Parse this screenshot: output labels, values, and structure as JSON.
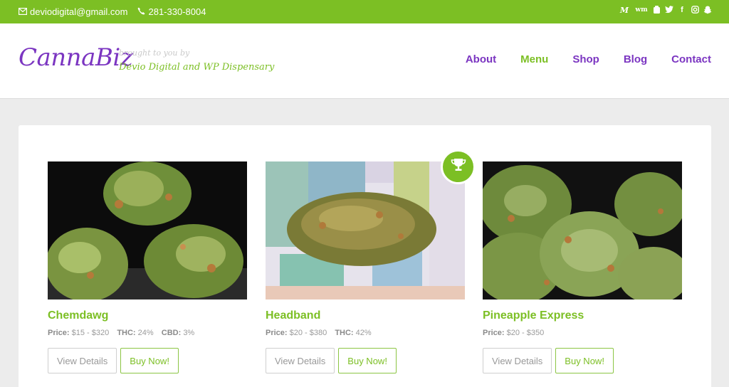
{
  "topbar": {
    "email": "deviodigital@gmail.com",
    "phone": "281-330-8004",
    "social_icons": [
      "weedmaps-icon",
      "wm-icon",
      "leafly-icon",
      "twitter-icon",
      "facebook-icon",
      "instagram-icon",
      "snapchat-icon"
    ],
    "bg_color": "#7cbf24"
  },
  "header": {
    "logo": "CannaBiz",
    "tagline_line1": "brought to you by",
    "tagline_line2": "Devio Digital and WP Dispensary",
    "nav": [
      {
        "label": "About",
        "active": false
      },
      {
        "label": "Menu",
        "active": true
      },
      {
        "label": "Shop",
        "active": false
      },
      {
        "label": "Blog",
        "active": false
      },
      {
        "label": "Contact",
        "active": false
      }
    ],
    "brand_color": "#7b35c1",
    "accent_color": "#7cbf24"
  },
  "products": [
    {
      "name": "Chemdawg",
      "price_label": "Price:",
      "price": "$15 - $320",
      "thc_label": "THC:",
      "thc": "24%",
      "cbd_label": "CBD:",
      "cbd": "3%",
      "view_label": "View Details",
      "buy_label": "Buy Now!"
    },
    {
      "name": "Headband",
      "price_label": "Price:",
      "price": "$20 - $380",
      "thc_label": "THC:",
      "thc": "42%",
      "view_label": "View Details",
      "buy_label": "Buy Now!",
      "featured_icon": "trophy-icon"
    },
    {
      "name": "Pineapple Express",
      "price_label": "Price:",
      "price": "$20 - $350",
      "view_label": "View Details",
      "buy_label": "Buy Now!"
    }
  ]
}
